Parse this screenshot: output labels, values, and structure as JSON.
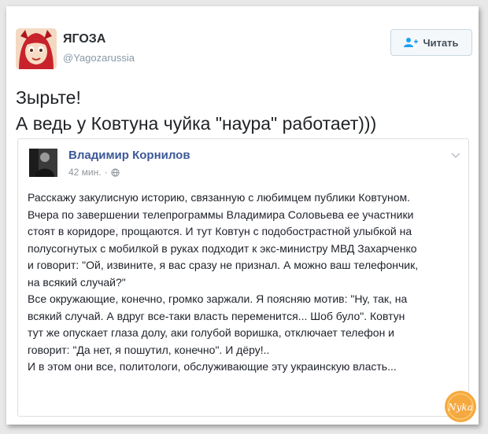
{
  "tweet": {
    "author_name": "ЯГОЗА",
    "handle": "@Yagozarussia",
    "follow_label": "Читать",
    "text_lines": [
      "Зырьте!",
      "А ведь у Ковтуна чуйка \"наура\" работает)))"
    ]
  },
  "embedded_post": {
    "author_name": "Владимир Корнилов",
    "time": "42 мин.",
    "body_lines": [
      "Расскажу закулисную историю, связанную с любимцем публики Ковтуном.",
      "Вчера по завершении телепрограммы Владимира Соловьева ее участники",
      "стоят в коридоре, прощаются. И тут Ковтун с подобострастной улыбкой на",
      "полусогнутых с мобилкой в руках подходит к экс-министру МВД Захарченко",
      "и говорит: \"Ой, извините, я вас сразу не признал. А можно ваш телефончик,",
      "на всякий случай?\"",
      "Все окружающие, конечно, громко заржали. Я поясняю мотив: \"Ну, так, на",
      "всякий случай. А вдруг все-таки власть переменится... Шоб було\". Ковтун",
      "тут же опускает глаза долу, аки голубой воришка, отключает телефон и",
      "говорит: \"Да нет, я пошутил, конечно\". И дёру!..",
      "И в этом они все, политологи, обслуживающие эту украинскую власть..."
    ]
  },
  "watermark": {
    "text": "Nyka"
  },
  "colors": {
    "accent": "#3b5998",
    "follow_icon": "#1da1f2",
    "watermark": "#f39a1e"
  }
}
